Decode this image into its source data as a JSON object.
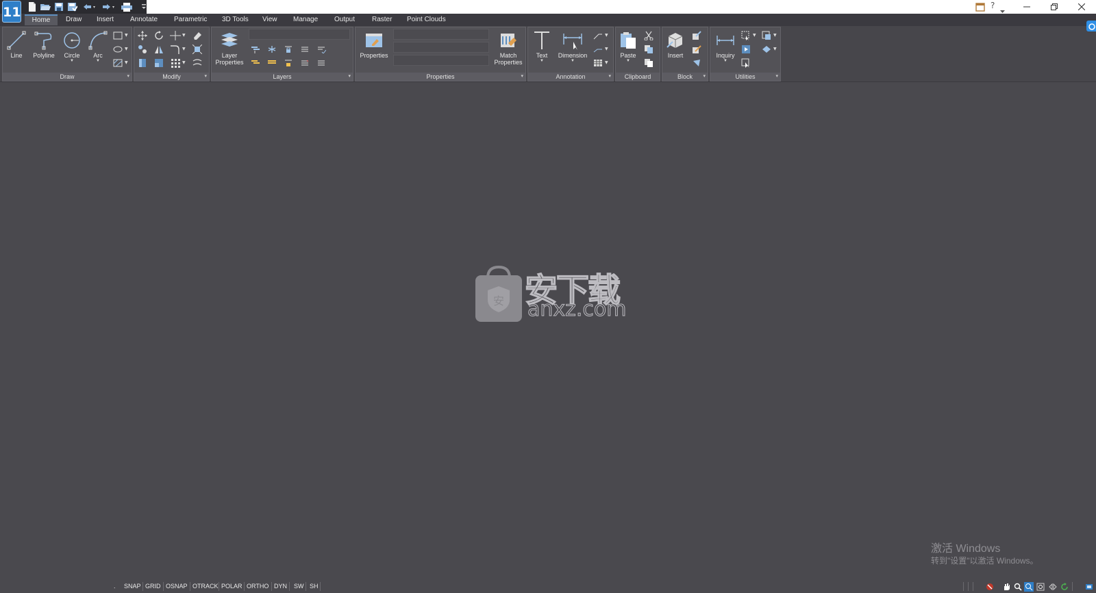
{
  "app": {
    "logo_text": "11"
  },
  "tabs": [
    "Home",
    "Draw",
    "Insert",
    "Annotate",
    "Parametric",
    "3D Tools",
    "View",
    "Manage",
    "Output",
    "Raster",
    "Point Clouds"
  ],
  "active_tab": "Home",
  "panels": {
    "draw": {
      "label": "Draw",
      "buttons": [
        "Line",
        "Polyline",
        "Circle",
        "Arc"
      ]
    },
    "modify": {
      "label": "Modify"
    },
    "layers": {
      "label": "Layers",
      "button_line1": "Layer",
      "button_line2": "Properties"
    },
    "properties": {
      "label": "Properties",
      "button": "Properties",
      "match_line1": "Match",
      "match_line2": "Properties"
    },
    "annotation": {
      "label": "Annotation",
      "buttons": [
        "Text",
        "Dimension"
      ]
    },
    "clipboard": {
      "label": "Clipboard",
      "button": "Paste"
    },
    "block": {
      "label": "Block",
      "button": "Insert"
    },
    "utilities": {
      "label": "Utilities",
      "button": "Inquiry"
    }
  },
  "watermark": {
    "text": "安下载",
    "sub": "anxz.com"
  },
  "activation": {
    "title": "激活 Windows",
    "subtitle": "转到\"设置\"以激活 Windows。"
  },
  "statusbar": {
    "dot": ".",
    "toggles": [
      "SNAP",
      "GRID",
      "OSNAP",
      "OTRACK",
      "POLAR",
      "ORTHO",
      "DYN",
      "SW",
      "SH"
    ]
  },
  "colors": {
    "canvas": "#4a494e",
    "ribbon_panel": "#535257",
    "accent": "#2f7fc8"
  },
  "icons": [
    "new-file-icon",
    "open-folder-icon",
    "save-icon",
    "save-as-icon",
    "undo-icon",
    "redo-icon",
    "print-icon",
    "help-icon",
    "minimize-icon",
    "restore-icon",
    "close-icon"
  ]
}
